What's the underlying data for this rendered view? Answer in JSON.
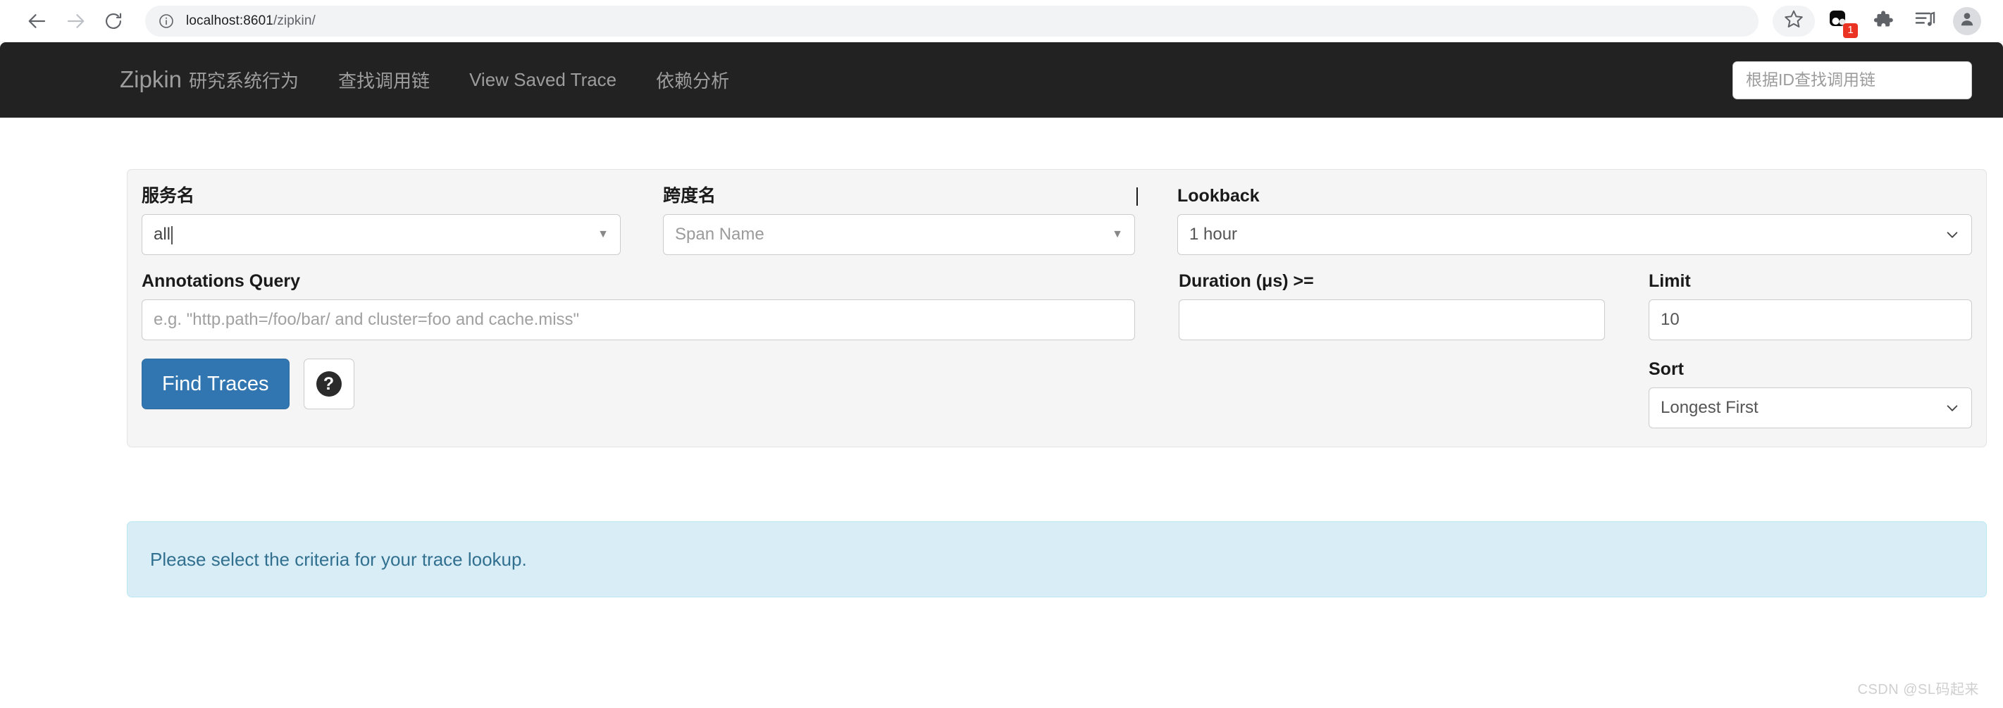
{
  "browser": {
    "back_icon": "arrow-left-icon",
    "forward_icon": "arrow-right-icon",
    "reload_icon": "reload-icon",
    "site_info_icon": "info-circle-icon",
    "url_host": "localhost:8601",
    "url_path": "/zipkin/",
    "url_full": "localhost:8601/zipkin/",
    "bookmark_icon": "star-icon",
    "extension_icon": "extension-icon",
    "extension_badge": "1",
    "puzzle_icon": "puzzle-piece-icon",
    "media_icon": "media-playlist-icon",
    "profile_icon": "avatar-icon"
  },
  "navbar": {
    "brand": "Zipkin",
    "brand_subtitle": "研究系统行为",
    "links": [
      {
        "label": "查找调用链"
      },
      {
        "label": "View Saved Trace"
      },
      {
        "label": "依赖分析"
      }
    ],
    "search_placeholder": "根据ID查找调用链",
    "search_value": "",
    "background": "#222222",
    "text_color": "#9d9d9d"
  },
  "form": {
    "service_name": {
      "label": "服务名",
      "value": "all",
      "caret_icon": "triangle-down-icon"
    },
    "span_name": {
      "label": "跨度名",
      "placeholder": "Span Name",
      "value": "",
      "caret_icon": "triangle-down-icon"
    },
    "lookback": {
      "label": "Lookback",
      "value": "1 hour",
      "chevron_icon": "chevron-down-icon",
      "options": [
        "1 hour"
      ]
    },
    "annotations_query": {
      "label": "Annotations Query",
      "placeholder": "e.g. \"http.path=/foo/bar/ and cluster=foo and cache.miss\"",
      "value": ""
    },
    "duration": {
      "label": "Duration (μs) >=",
      "value": "",
      "placeholder": ""
    },
    "limit": {
      "label": "Limit",
      "value": "10"
    },
    "sort": {
      "label": "Sort",
      "value": "Longest First",
      "chevron_icon": "chevron-down-icon",
      "options": [
        "Longest First"
      ]
    },
    "find_traces_button": "Find Traces",
    "help_button_glyph": "?",
    "primary_color": "#3276b1",
    "panel_background": "#f5f5f5"
  },
  "alert": {
    "message": "Please select the criteria for your trace lookup.",
    "background": "#d9edf7",
    "border": "#bce8f1",
    "text_color": "#31708f"
  },
  "watermark": {
    "text": "CSDN @SL码起来"
  }
}
